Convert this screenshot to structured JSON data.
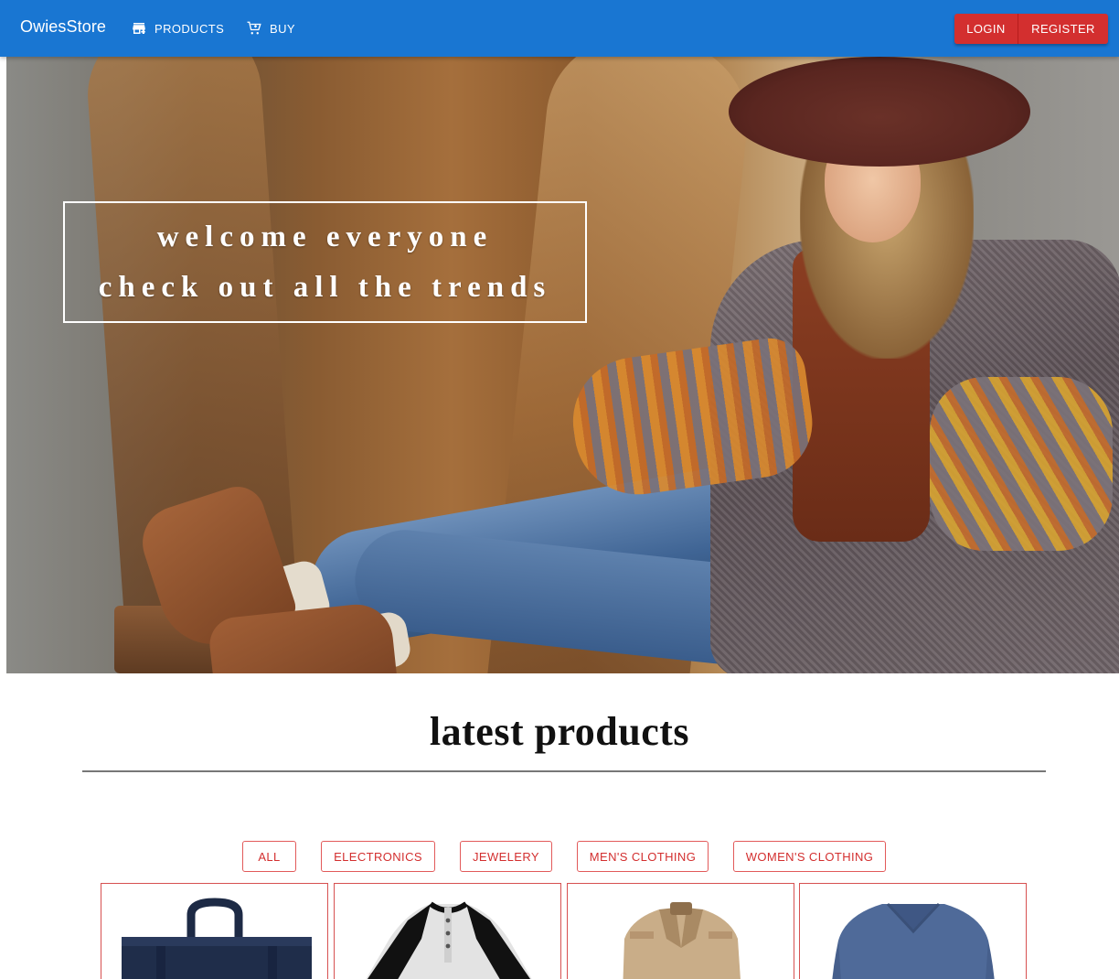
{
  "header": {
    "brand": "OwiesStore",
    "nav": [
      {
        "label": "PRODUCTS",
        "icon": "store-icon"
      },
      {
        "label": "BUY",
        "icon": "cart-icon"
      }
    ],
    "auth": {
      "login_label": "LOGIN",
      "register_label": "REGISTER"
    },
    "colors": {
      "appbar": "#1976d2",
      "auth_button": "#d32f2f"
    }
  },
  "hero": {
    "line1": "welcome everyone",
    "line2": "check out all the trends"
  },
  "latest": {
    "title": "latest products",
    "filters": [
      "ALL",
      "ELECTRONICS",
      "JEWELERY",
      "MEN'S CLOTHING",
      "WOMEN'S CLOTHING"
    ],
    "filter_color": "#d32f2f",
    "products": [
      {
        "image": "backpack-image"
      },
      {
        "image": "raglan-shirt-image"
      },
      {
        "image": "jacket-image"
      },
      {
        "image": "vneck-tshirt-image"
      }
    ]
  }
}
